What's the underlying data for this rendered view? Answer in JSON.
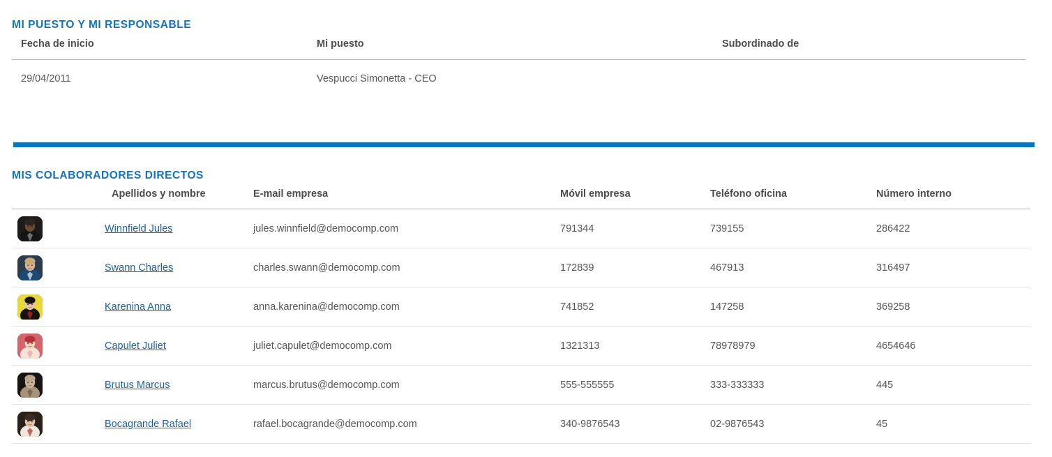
{
  "colors": {
    "accent_blue": "#1273bd",
    "divider_blue": "#0c75b9",
    "link_blue": "#1763a8",
    "header_text": "#4c4c4c",
    "body_text": "#555555",
    "header_rule": "#b4b4b4",
    "row_rule": "#e3e3e3"
  },
  "section_position": {
    "title": "MI PUESTO Y MI RESPONSABLE",
    "columns": [
      "Fecha de inicio",
      "Mi puesto",
      "Subordinado de"
    ],
    "rows": [
      {
        "start_date": "29/04/2011",
        "job_title": "Vespucci Simonetta - CEO",
        "reports_to": ""
      }
    ]
  },
  "section_team": {
    "title": "MIS COLABORADORES DIRECTOS",
    "columns": [
      "",
      "Apellidos y nombre",
      "E-mail empresa",
      "Móvil empresa",
      "Teléfono oficina",
      "Número interno"
    ],
    "rows": [
      {
        "avatar": "avatar-winnfield-jules",
        "name": "Winnfield Jules",
        "email": "jules.winnfield@democomp.com",
        "mobile": "791344",
        "office_phone": "739155",
        "internal_number": "286422"
      },
      {
        "avatar": "avatar-swann-charles",
        "name": "Swann Charles",
        "email": "charles.swann@democomp.com",
        "mobile": "172839",
        "office_phone": "467913",
        "internal_number": "316497"
      },
      {
        "avatar": "avatar-karenina-anna",
        "name": "Karenina Anna",
        "email": "anna.karenina@democomp.com",
        "mobile": "741852",
        "office_phone": "147258",
        "internal_number": "369258"
      },
      {
        "avatar": "avatar-capulet-juliet",
        "name": "Capulet Juliet",
        "email": "juliet.capulet@democomp.com",
        "mobile": "1321313",
        "office_phone": "78978979",
        "internal_number": "4654646"
      },
      {
        "avatar": "avatar-brutus-marcus",
        "name": "Brutus Marcus",
        "email": "marcus.brutus@democomp.com",
        "mobile": "555-555555",
        "office_phone": "333-333333",
        "internal_number": "445"
      },
      {
        "avatar": "avatar-bocagrande-rafael",
        "name": "Bocagrande Rafael",
        "email": "rafael.bocagrande@democomp.com",
        "mobile": "340-9876543",
        "office_phone": "02-9876543",
        "internal_number": "45"
      }
    ]
  }
}
